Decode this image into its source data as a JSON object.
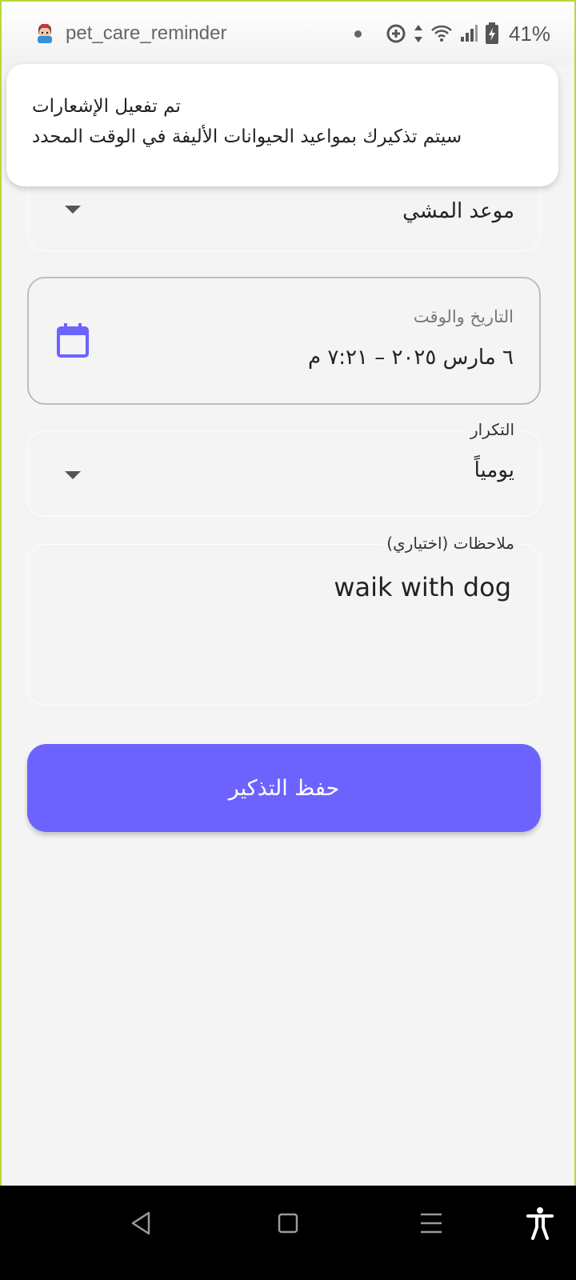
{
  "status_bar": {
    "app_name": "pet_care_reminder",
    "battery": "41%",
    "icons": [
      "app-avatar-icon",
      "notification-dot-icon",
      "data-saver-icon",
      "data-arrows-icon",
      "wifi-icon",
      "signal-icon",
      "battery-charging-icon"
    ]
  },
  "notification": {
    "title": "تم تفعيل الإشعارات",
    "body": "سيتم تذكيرك بمواعيد الحيوانات الأليفة في الوقت المحدد"
  },
  "form": {
    "reminder_type": {
      "value": "موعد المشي"
    },
    "datetime": {
      "label": "التاريخ والوقت",
      "value": "٦ مارس ٢٠٢٥ – ٧:٢١ م"
    },
    "repeat": {
      "label": "التكرار",
      "value": "يومياً"
    },
    "notes": {
      "label": "ملاحظات (اختياري)",
      "value": "waik with dog"
    }
  },
  "save_button": {
    "label": "حفظ التذكير"
  },
  "colors": {
    "accent": "#6c63ff",
    "background": "#f4f4f4",
    "frame": "#b5d93a"
  },
  "nav_bar": {
    "icons": [
      "back-icon",
      "home-icon",
      "recents-icon",
      "accessibility-icon"
    ]
  }
}
